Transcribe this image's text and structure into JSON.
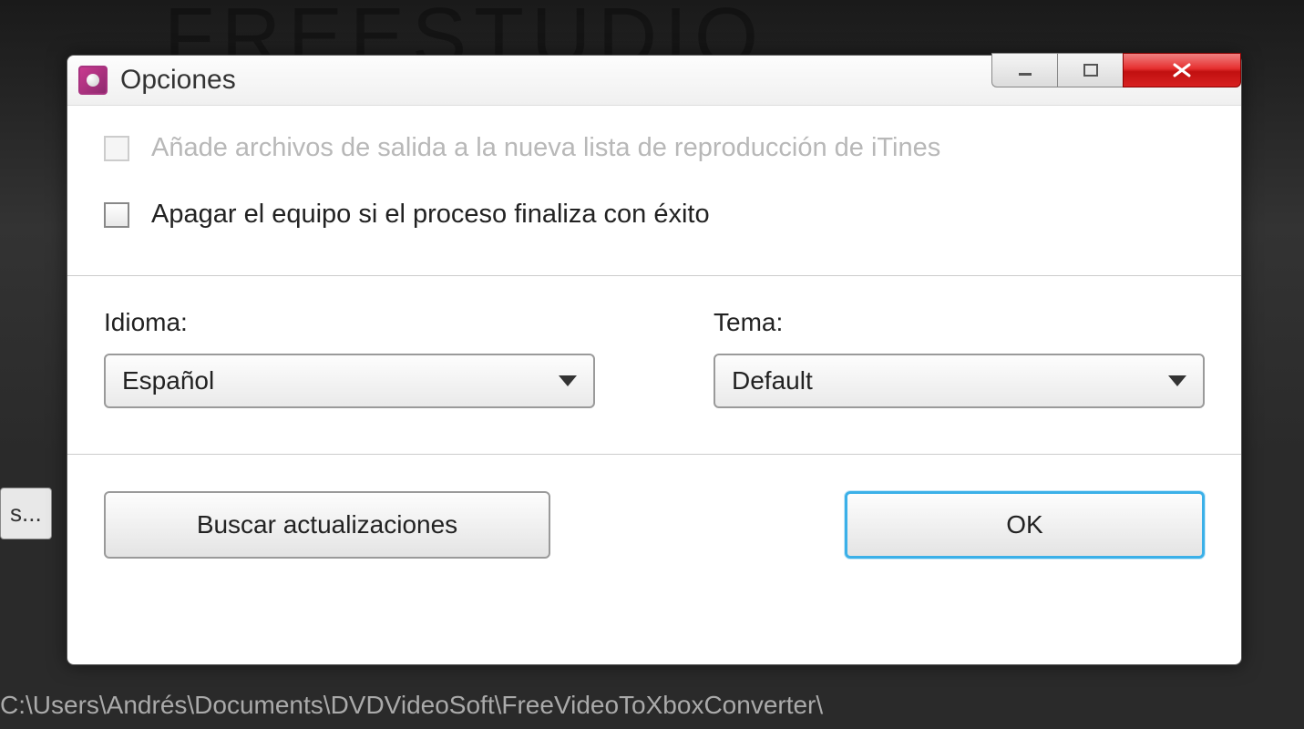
{
  "background": {
    "app_title": "FREESTUDIO",
    "browse_button_suffix": "s...",
    "path": "C:\\Users\\Andrés\\Documents\\DVDVideoSoft\\FreeVideoToXboxConverter\\"
  },
  "dialog": {
    "title": "Opciones",
    "checkbox_itunes": {
      "label": "Añade archivos de salida a la nueva lista de reproducción de iTines",
      "checked": false,
      "enabled": false
    },
    "checkbox_shutdown": {
      "label": "Apagar el equipo si el proceso finaliza con éxito",
      "checked": false,
      "enabled": true
    },
    "language": {
      "label": "Idioma:",
      "value": "Español"
    },
    "theme": {
      "label": "Tema:",
      "value": "Default"
    },
    "buttons": {
      "check_updates": "Buscar actualizaciones",
      "ok": "OK"
    }
  }
}
